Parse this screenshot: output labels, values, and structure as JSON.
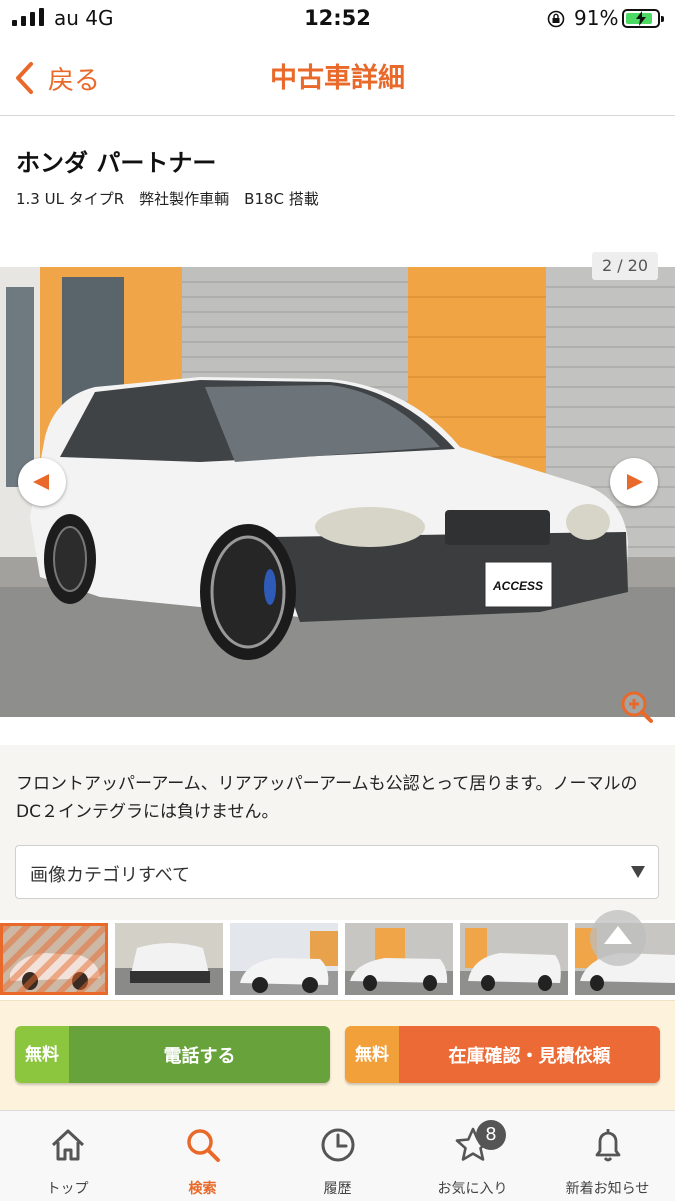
{
  "status": {
    "carrier": "au  4G",
    "time": "12:52",
    "battery": "91%",
    "battery_level": 0.91
  },
  "nav": {
    "back_label": "戻る",
    "title": "中古車詳細"
  },
  "car": {
    "title": "ホンダ  パートナー",
    "subtitle": "1.3 UL タイプR　弊社製作車輌　B18C 搭載",
    "plate_text": "ACCESS"
  },
  "gallery": {
    "counter": "2 / 20"
  },
  "description": "フロントアッパーアーム、リアアッパーアームも公認とって居ります。ノーマルのDC２インテグラには負けません。",
  "image_category": {
    "selected": "画像カテゴリすべて"
  },
  "cta": {
    "call": {
      "free": "無料",
      "label": "電話する"
    },
    "inquiry": {
      "free": "無料",
      "label": "在庫確認・見積依頼"
    }
  },
  "tabs": [
    {
      "label": "トップ",
      "icon": "home-icon"
    },
    {
      "label": "検索",
      "icon": "search-icon",
      "active": true
    },
    {
      "label": "履歴",
      "icon": "clock-icon"
    },
    {
      "label": "お気に入り",
      "icon": "star-icon",
      "badge": "8"
    },
    {
      "label": "新着お知らせ",
      "icon": "bell-icon"
    }
  ],
  "colors": {
    "accent": "#e8692a",
    "call_green": "#67a23b",
    "inquiry_orange": "#ec6a35",
    "free_green": "#8cc63f",
    "free_orange": "#f2a03a"
  }
}
